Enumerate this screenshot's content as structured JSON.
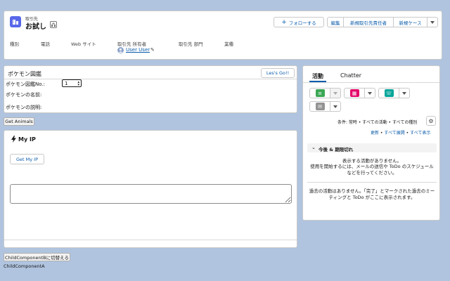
{
  "header": {
    "object_type": "取引先",
    "record_name": "お試し",
    "buttons": {
      "follow": "フォローする",
      "edit": "編集",
      "new_contact": "新規取引先責任者",
      "new_case": "新規ケース"
    },
    "fields": [
      {
        "label": "種別",
        "value": ""
      },
      {
        "label": "電話",
        "value": ""
      },
      {
        "label": "Web サイト",
        "value": ""
      },
      {
        "label": "取引先 所有者",
        "value": "User User"
      },
      {
        "label": "取引先 部門",
        "value": ""
      },
      {
        "label": "業種",
        "value": ""
      }
    ]
  },
  "pokemon": {
    "title": "ポケモン図鑑",
    "go_button": "Les's Go!!",
    "no_label": "ポケモン図鑑No.:",
    "no_value": "1",
    "name_label": "ポケモンの名前:",
    "desc_label": "ポケモンの説明:"
  },
  "animals_button": "Get Animals",
  "myip": {
    "title": "My IP",
    "button": "Get My IP",
    "textarea_value": ""
  },
  "switch_button": "ChildComponentBに切替える",
  "child_label": "ChildComponentA",
  "activity": {
    "tabs": [
      "活動",
      "Chatter"
    ],
    "filter_text": "条件: 常時 • すべての活動 • すべての種別",
    "links": [
      "更新",
      "すべて展開",
      "すべて表示"
    ],
    "separator": " • ",
    "upcoming_title": "今後 & 期限切れ",
    "upcoming_empty": "表示する活動がありません。",
    "upcoming_hint": "使用を開始するには、メールの送信や ToDo のスケジュールなどを行ってください。",
    "past_empty": "過去の活動はありません。「完了」とマークされた過去のミーティングと ToDo がここに表示されます。"
  },
  "colors": {
    "accent": "#0b5cab",
    "record_icon": "#5867e8",
    "log_call": "#3ba755",
    "event": "#e3066a",
    "task": "#06a59a",
    "email": "#939393",
    "background": "#b0c4df"
  }
}
